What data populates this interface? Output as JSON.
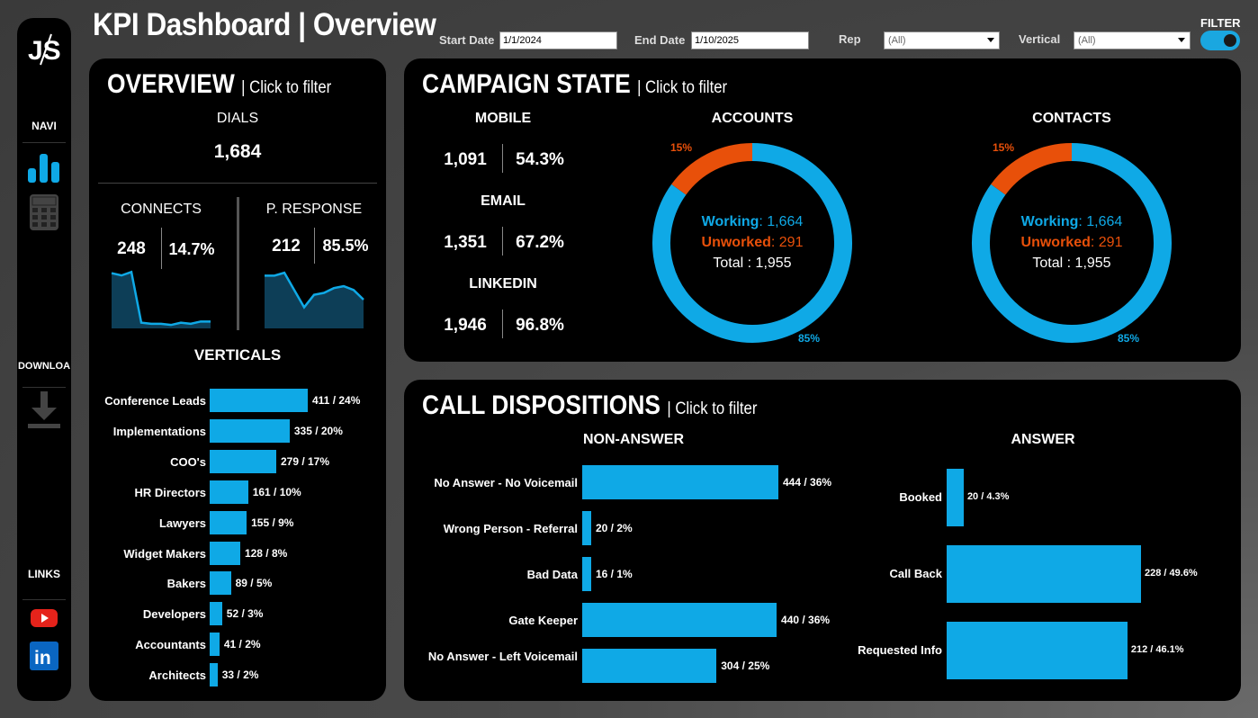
{
  "header": {
    "title": "KPI Dashboard | Overview",
    "start_date_label": "Start Date",
    "start_date_value": "1/1/2024",
    "end_date_label": "End Date",
    "end_date_value": "1/10/2025",
    "rep_label": "Rep",
    "rep_value": "(All)",
    "vertical_label": "Vertical",
    "vertical_value": "(All)",
    "filter_label": "FILTER",
    "filter_toggle_on": true
  },
  "sidebar": {
    "logo": "JS",
    "navi_label": "NAVI",
    "download_label": "DOWNLOA",
    "links_label": "LINKS",
    "icons": [
      "bar-chart-icon",
      "calculator-icon",
      "download-icon",
      "youtube-icon",
      "linkedin-icon"
    ]
  },
  "overview": {
    "title": "OVERVIEW",
    "subtitle": "| Click to filter",
    "dials_label": "DIALS",
    "dials_value": "1,684",
    "connects_label": "CONNECTS",
    "connects_value": "248",
    "connects_pct": "14.7%",
    "presponse_label": "P. RESPONSE",
    "presponse_value": "212",
    "presponse_pct": "85.5%",
    "verticals_label": "VERTICALS"
  },
  "campaign": {
    "title": "CAMPAIGN STATE",
    "subtitle": "| Click to filter",
    "mobile_label": "MOBILE",
    "mobile_value": "1,091",
    "mobile_pct": "54.3%",
    "email_label": "EMAIL",
    "email_value": "1,351",
    "email_pct": "67.2%",
    "linkedin_label": "LINKEDIN",
    "linkedin_value": "1,946",
    "linkedin_pct": "96.8%",
    "accounts": {
      "label": "ACCOUNTS",
      "working_label": "Working",
      "working_value": ": 1,664",
      "unworked_label": "Unworked",
      "unworked_value": ": 291",
      "total": "Total : 1,955",
      "pct_unworked": "15%",
      "pct_working": "85%"
    },
    "contacts": {
      "label": "CONTACTS",
      "working_label": "Working",
      "working_value": ": 1,664",
      "unworked_label": "Unworked",
      "unworked_value": ": 291",
      "total": "Total : 1,955",
      "pct_unworked": "15%",
      "pct_working": "85%"
    }
  },
  "dispositions": {
    "title": "CALL DISPOSITIONS",
    "subtitle": "| Click to filter",
    "nonanswer_label": "NON-ANSWER",
    "answer_label": "ANSWER"
  },
  "colors": {
    "accent_blue": "#0fa9e6",
    "accent_orange": "#e8500a",
    "panel_bg": "#000000"
  },
  "chart_data": [
    {
      "type": "area",
      "name_ref": "connects-sparkline",
      "x": [
        1,
        2,
        3,
        4,
        5,
        6,
        7,
        8,
        9,
        10,
        11
      ],
      "values": [
        48,
        46,
        49,
        5,
        4,
        4,
        3,
        5,
        4,
        6,
        6
      ]
    },
    {
      "type": "area",
      "name_ref": "presponse-sparkline",
      "x": [
        1,
        2,
        3,
        4,
        5,
        6,
        7,
        8,
        9,
        10,
        11
      ],
      "values": [
        55,
        55,
        58,
        40,
        22,
        35,
        37,
        42,
        44,
        40,
        30
      ]
    },
    {
      "type": "bar",
      "orientation": "horizontal",
      "categories": [
        "Conference Leads",
        "Implementations",
        "COO's",
        "HR Directors",
        "Lawyers",
        "Widget Makers",
        "Bakers",
        "Developers",
        "Accountants",
        "Architects"
      ],
      "values": [
        411,
        335,
        279,
        161,
        155,
        128,
        89,
        52,
        41,
        33
      ],
      "labels": [
        "411 / 24%",
        "335 / 20%",
        "279 / 17%",
        "161 / 10%",
        "155 / 9%",
        "128 / 8%",
        "89 / 5%",
        "52 / 3%",
        "41 / 2%",
        "33 / 2%"
      ]
    },
    {
      "type": "pie",
      "name_ref": "accounts-donut",
      "categories": [
        "Working",
        "Unworked"
      ],
      "values": [
        85,
        15
      ]
    },
    {
      "type": "pie",
      "name_ref": "contacts-donut",
      "categories": [
        "Working",
        "Unworked"
      ],
      "values": [
        85,
        15
      ]
    },
    {
      "type": "bar",
      "orientation": "horizontal",
      "name_ref": "non-answer",
      "categories": [
        "No Answer - No Voicemail",
        "Wrong Person - Referral",
        "Bad Data",
        "Gate Keeper",
        "No Answer - Left Voicemail"
      ],
      "values": [
        444,
        20,
        16,
        440,
        304
      ],
      "labels": [
        "444 / 36%",
        "20 / 2%",
        "16 / 1%",
        "440 / 36%",
        "304 / 25%"
      ]
    },
    {
      "type": "bar",
      "orientation": "horizontal",
      "name_ref": "answer",
      "categories": [
        "Booked",
        "Call Back",
        "Requested Info"
      ],
      "values": [
        20,
        228,
        212
      ],
      "labels": [
        "20 / 4.3%",
        "228 / 49.6%",
        "212 / 46.1%"
      ]
    }
  ]
}
